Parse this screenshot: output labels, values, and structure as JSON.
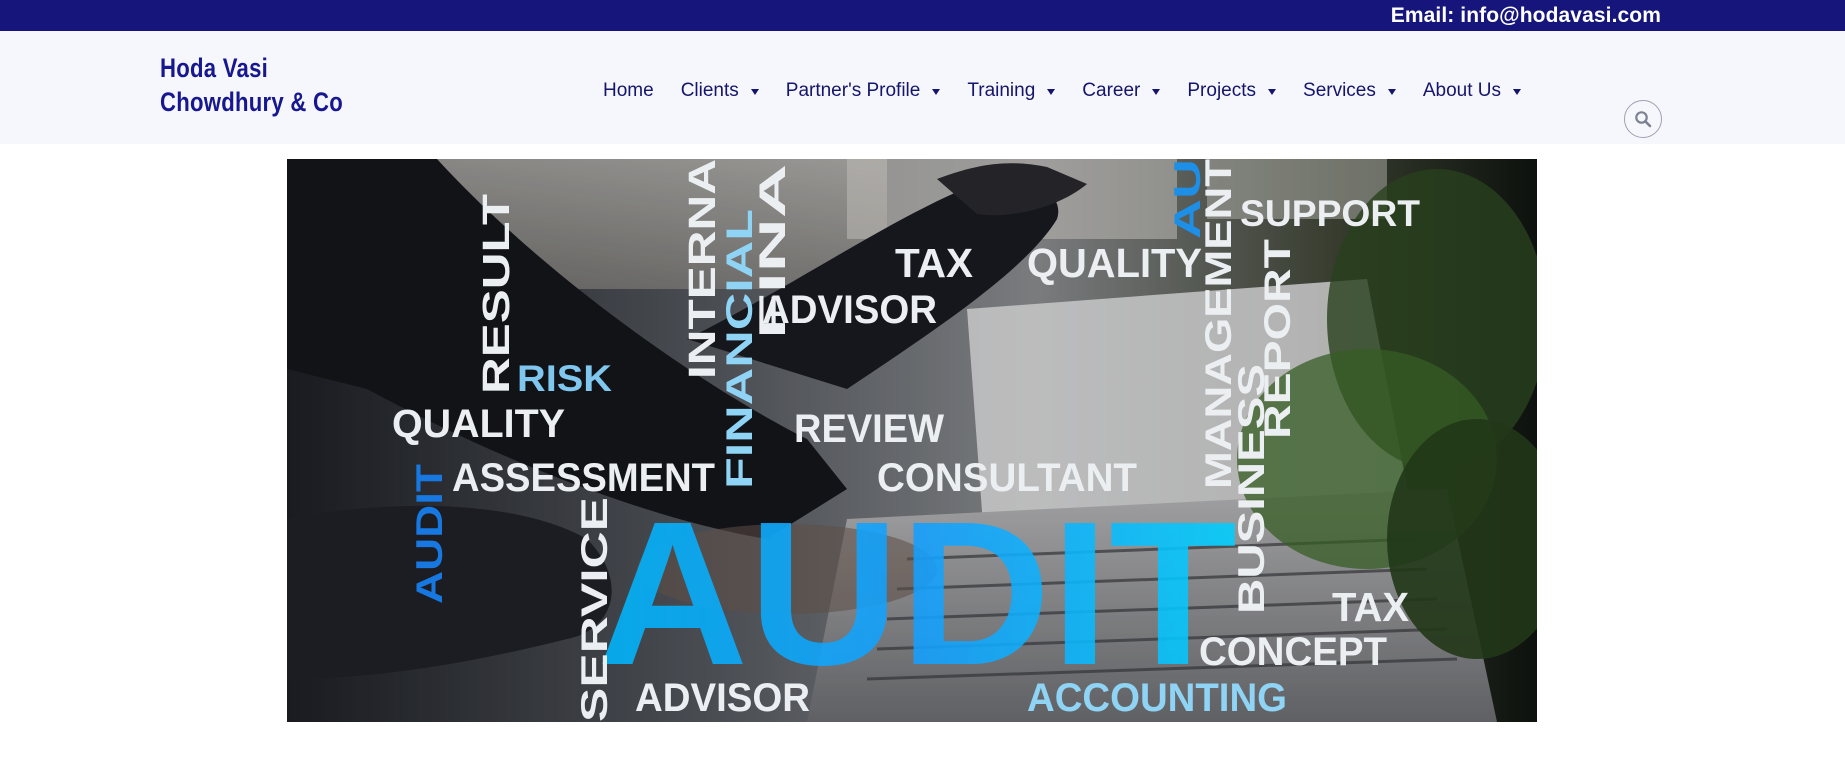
{
  "topbar": {
    "email_text": "Email: info@hodavasi.com",
    "background": "#15157c"
  },
  "logo": {
    "line1": "Hoda Vasi",
    "line2": "Chowdhury & Co",
    "color": "#17178f"
  },
  "nav": {
    "items": [
      {
        "label": "Home",
        "has_dropdown": false
      },
      {
        "label": "Clients",
        "has_dropdown": true
      },
      {
        "label": "Partner's Profile",
        "has_dropdown": true
      },
      {
        "label": "Training",
        "has_dropdown": true
      },
      {
        "label": "Career",
        "has_dropdown": true
      },
      {
        "label": "Projects",
        "has_dropdown": true
      },
      {
        "label": "Services",
        "has_dropdown": true
      },
      {
        "label": "About Us",
        "has_dropdown": true
      }
    ],
    "text_color": "#15156b"
  },
  "search": {
    "icon": "search-icon"
  },
  "hero": {
    "words": {
      "audit_big": "AUDIT",
      "support": "SUPPORT",
      "tax_top": "TAX",
      "quality_top": "QUALITY",
      "advisor_top": "ADVISOR",
      "result": "RESULT",
      "interna": "INTERNA",
      "financial": "FINANCIAL",
      "fina": "FINA",
      "risk": "RISK",
      "quality_left": "QUALITY",
      "review": "REVIEW",
      "consultant": "CONSULTANT",
      "assessment": "ASSESSMENT",
      "audit_small": "AUDIT",
      "service": "SERVICE",
      "management": "MANAGEMENT",
      "business": "BUSINESS",
      "report": "REPORT",
      "au": "AU",
      "tax_bottom": "TAX",
      "concept": "CONCEPT",
      "advisor_bottom": "ADVISOR",
      "accounting": "ACCOUNTING"
    }
  }
}
